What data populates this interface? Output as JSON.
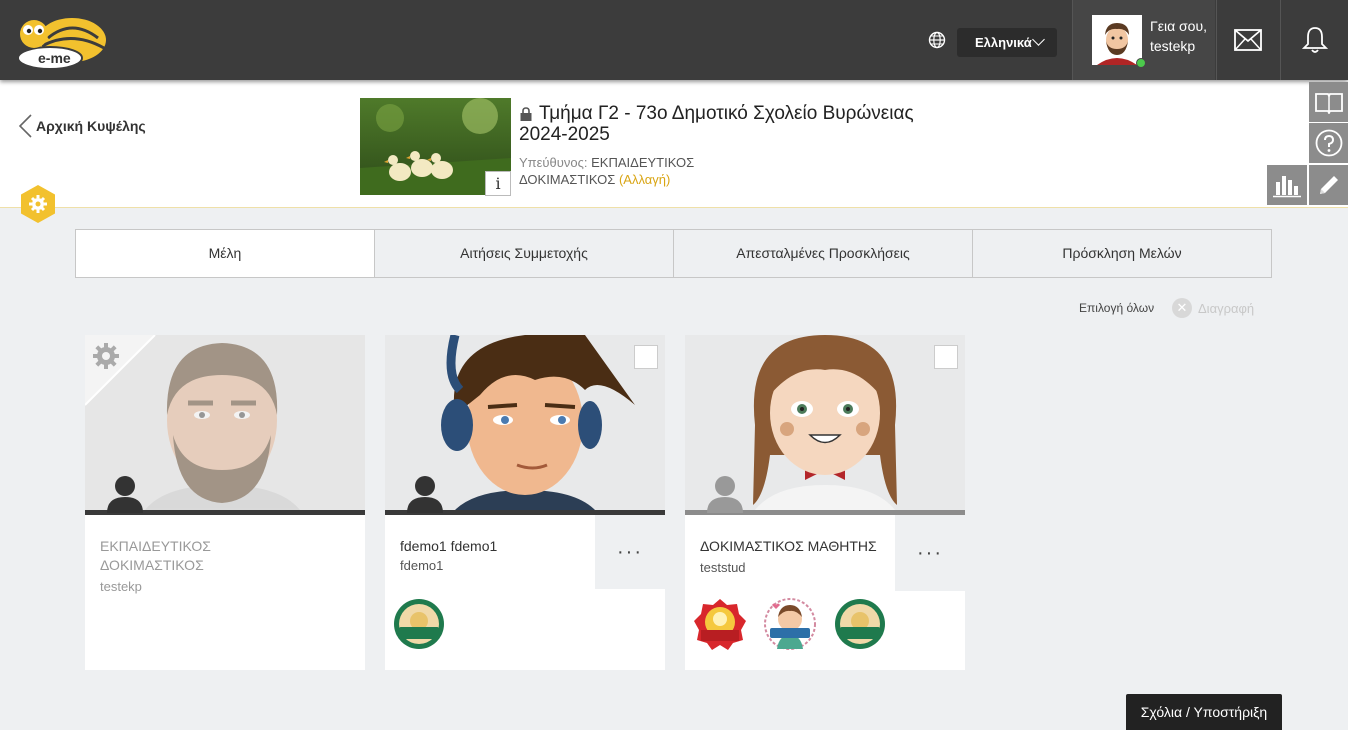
{
  "header": {
    "logo_text": "e-me",
    "language": "Ελληνικά",
    "greeting": "Γεια σου,",
    "username": "testekp"
  },
  "page": {
    "back_label": "Αρχική Κυψέλης",
    "class_title": "Τμήμα Γ2 - 73ο Δημοτικό Σχολείο Βυρώνειας 2024-2025",
    "responsible_label": "Υπεύθυνος:",
    "responsible_name": "ΕΚΠΑΙΔΕΥΤΙΚΟΣ ΔΟΚΙΜΑΣΤΙΚΟΣ",
    "change_label": "(Αλλαγή)",
    "info_label": "i"
  },
  "tabs": [
    {
      "label": "Μέλη",
      "active": true
    },
    {
      "label": "Αιτήσεις Συμμετοχής",
      "active": false
    },
    {
      "label": "Απεσταλμένες Προσκλήσεις",
      "active": false
    },
    {
      "label": "Πρόσκληση Μελών",
      "active": false
    }
  ],
  "actions": {
    "select_all": "Επιλογή όλων",
    "delete": "Διαγραφή"
  },
  "members": [
    {
      "name": "ΕΚΠΑΙΔΕΥΤΙΚΟΣ ΔΟΚΙΜΑΣΤΙΚΟΣ",
      "username": "testekp",
      "role": "owner",
      "badges": []
    },
    {
      "name": "fdemo1 fdemo1",
      "username": "fdemo1",
      "role": "member",
      "badges": [
        "Εξαιρετικής συμπεριφοράς"
      ]
    },
    {
      "name": "ΔΟΚΙΜΑΣΤΙΚΟΣ ΜΑΘΗΤΗΣ",
      "username": "teststud",
      "role": "member",
      "badges": [
        "Φωτεινού Πνεύματος",
        "Ευγένειας",
        "Εξαιρετικής συμπεριφοράς"
      ]
    }
  ],
  "more_label": "···",
  "feedback": "Σχόλια / Υποστήριξη",
  "colors": {
    "topbar": "#3c3c3c",
    "accent": "#f2c12e",
    "change_link": "#d9a514",
    "tool_button": "#8c8c8c"
  }
}
